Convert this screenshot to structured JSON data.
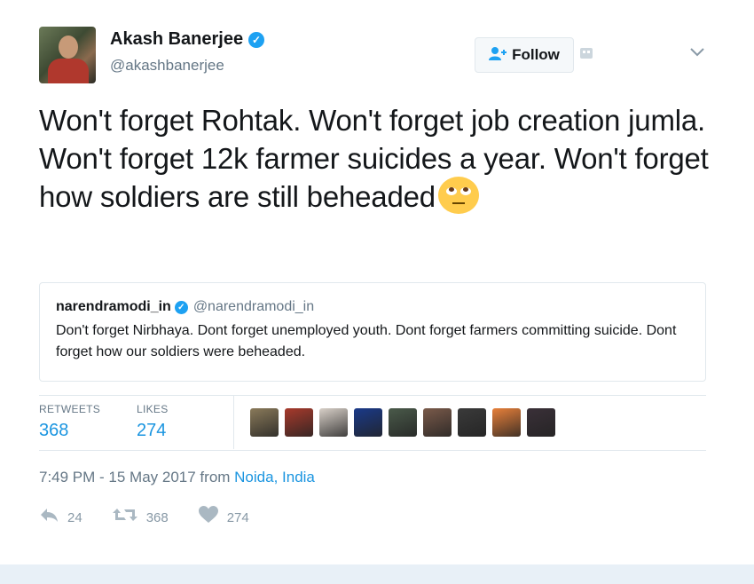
{
  "author": {
    "name": "Akash Banerjee",
    "handle": "@akashbanerjee",
    "verified_icon": "✓"
  },
  "follow_button": {
    "label": "Follow",
    "icon": "follow-person-icon"
  },
  "tweet": {
    "text": "Won't forget Rohtak. Won't forget job creation jumla. Won't forget 12k farmer suicides a year. Won't forget how soldiers are still beheaded",
    "emoji": "face-with-rolling-eyes"
  },
  "quoted_tweet": {
    "name": "narendramodi_in",
    "handle": "@narendramodi_in",
    "text": "Don't forget Nirbhaya. Dont forget unemployed youth. Dont forget farmers committing suicide. Dont forget how our soldiers were beheaded."
  },
  "stats": {
    "retweets_label": "RETWEETS",
    "retweets_value": "368",
    "likes_label": "LIKES",
    "likes_value": "274"
  },
  "likers": [
    {
      "name": "liker-avatar-1",
      "color": "#8a7a5a"
    },
    {
      "name": "liker-avatar-2",
      "color": "#a83a2c"
    },
    {
      "name": "liker-avatar-3",
      "color": "#d8d0c8"
    },
    {
      "name": "liker-avatar-4",
      "color": "#1a3a8a"
    },
    {
      "name": "liker-avatar-5",
      "color": "#4a5a4a"
    },
    {
      "name": "liker-avatar-6",
      "color": "#7a5a4a"
    },
    {
      "name": "liker-avatar-7",
      "color": "#3a3a3a"
    },
    {
      "name": "liker-avatar-8",
      "color": "#e8803a"
    },
    {
      "name": "liker-avatar-9",
      "color": "#3a3038"
    }
  ],
  "timestamp": {
    "text": "7:49 PM - 15 May 2017 from ",
    "location": "Noida, India"
  },
  "actions": {
    "reply_count": "24",
    "retweet_count": "368",
    "like_count": "274"
  },
  "colors": {
    "accent": "#1da1f2",
    "link": "#1b95e0",
    "muted": "#657786"
  }
}
